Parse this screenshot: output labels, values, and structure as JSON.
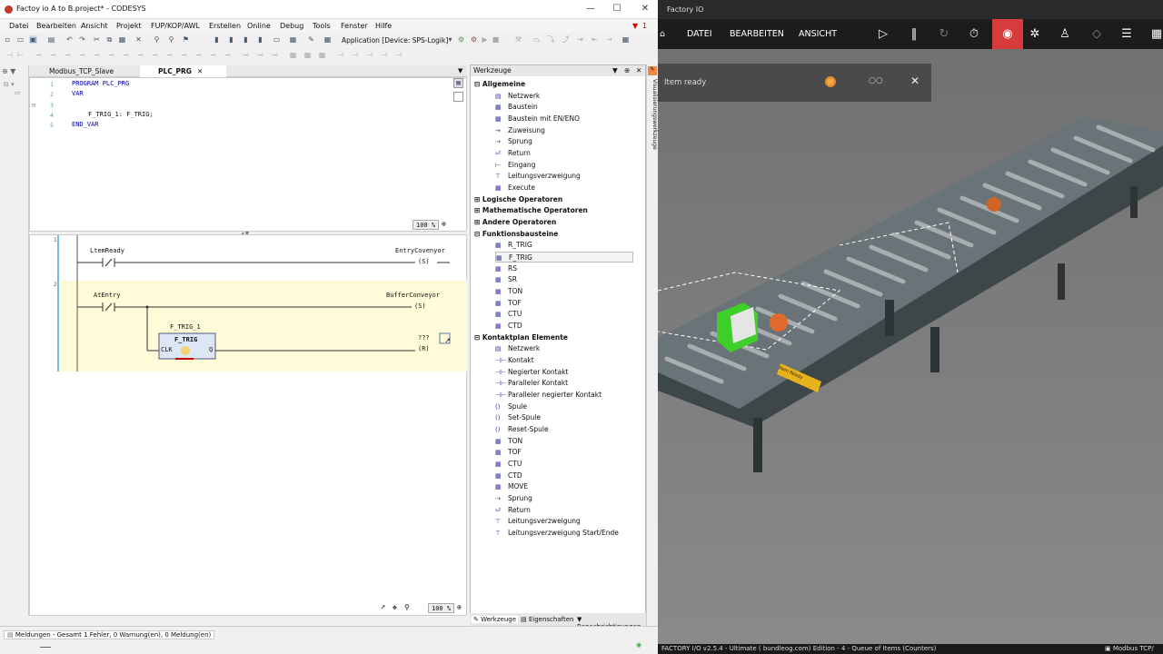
{
  "codesys": {
    "window_title": "Factoy io A to B.project* - CODESYS",
    "menu": [
      "Datei",
      "Bearbeiten",
      "Ansicht",
      "Projekt",
      "FUP/KOP/AWL",
      "Erstellen",
      "Online",
      "Debug",
      "Tools",
      "Fenster",
      "Hilfe"
    ],
    "application_label": "Application [Device: SPS-Logik]",
    "error_count": "1",
    "tabs": [
      "Modbus_TCP_Slave",
      "PLC_PRG"
    ],
    "declaration": {
      "line_numbers": [
        "1",
        "2",
        "3",
        "4",
        "5"
      ],
      "lines": [
        "PROGRAM PLC_PRG",
        "VAR",
        "",
        "F_TRIG_1: F_TRIG;",
        "END_VAR"
      ]
    },
    "decl_zoom": "100 %",
    "ladder": {
      "rung1": {
        "number": "1",
        "contact": "LtemReady",
        "coil": "EntryCovenyor",
        "coil_type": "(S)"
      },
      "rung2": {
        "number": "2",
        "contact": "AtEntry",
        "coil": "BufferConveyor",
        "coil_type": "(S)",
        "fb_instance": "F_TRIG_1",
        "fb_type": "F_TRIG",
        "fb_in": "CLK",
        "fb_out": "Q",
        "coil2": "???",
        "coil2_type": "(R)"
      }
    },
    "ladder_zoom": "100 %",
    "status_text": "Meldungen - Gesamt 1 Fehler, 0 Warnung(en), 0 Meldung(en)"
  },
  "tools": {
    "title": "Werkzeuge",
    "sections": [
      {
        "label": "Allgemeine",
        "expanded": true,
        "items": [
          "Netzwerk",
          "Baustein",
          "Baustein mit EN/ENO",
          "Zuweisung",
          "Sprung",
          "Return",
          "Eingang",
          "Leitungsverzweigung",
          "Execute"
        ]
      },
      {
        "label": "Logische Operatoren",
        "expanded": false,
        "items": []
      },
      {
        "label": "Mathematische Operatoren",
        "expanded": false,
        "items": []
      },
      {
        "label": "Andere Operatoren",
        "expanded": false,
        "items": []
      },
      {
        "label": "Funktionsbausteine",
        "expanded": true,
        "items": [
          "R_TRIG",
          "F_TRIG",
          "RS",
          "SR",
          "TON",
          "TOF",
          "CTU",
          "CTD"
        ]
      },
      {
        "label": "Kontaktplan Elemente",
        "expanded": true,
        "items": [
          "Netzwerk",
          "Kontakt",
          "Negierter Kontakt",
          "Paralleler Kontakt",
          "Paralleler negierter Kontakt",
          "Spule",
          "Set-Spule",
          "Reset-Spule",
          "TON",
          "TOF",
          "CTU",
          "CTD",
          "MOVE",
          "Sprung",
          "Return",
          "Leitungsverzweigung",
          "Leitungsverzweigung Start/Ende"
        ]
      }
    ],
    "bottom_tabs": [
      "Werkzeuge",
      "Eigenschaften",
      "Benachrichtigungen"
    ],
    "side_strip": "Visualisierungswerkzeuge"
  },
  "factory": {
    "window_title": "Factory IO",
    "menu": [
      "DATEI",
      "BEARBEITEN",
      "ANSICHT"
    ],
    "popup_text": "Item ready",
    "status_left": "FACTORY I/O v2.5.4 - Ultimate ( bundleog.com) Edition - 4 - Queue of Items (Counters)",
    "status_right": "Modbus TCP/",
    "sign_label": "Item Ready"
  }
}
